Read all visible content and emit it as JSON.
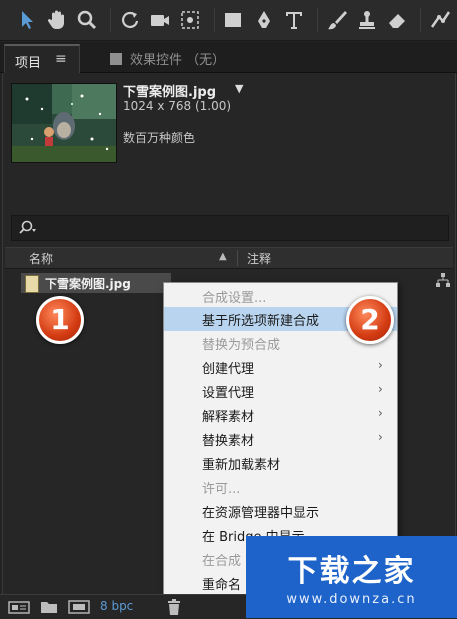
{
  "panel": {
    "project_tab": "项目",
    "project_menu": "≡",
    "effects_tab": "效果控件 （无）"
  },
  "footage": {
    "name": "下雪案例图.jpg",
    "caret": "▼",
    "dimensions": "1024 x 768 (1.00)",
    "colors": "数百万种颜色"
  },
  "columns": {
    "name": "名称",
    "sort": "▲",
    "comment": "注释"
  },
  "file_row": {
    "name": "下雪案例图.jpg"
  },
  "context_menu": {
    "items": [
      {
        "label": "合成设置...",
        "disabled": true
      },
      {
        "label": "基于所选项新建合成",
        "highlighted": true
      },
      {
        "label": "替换为预合成",
        "disabled": true
      },
      {
        "label": "创建代理",
        "submenu": true
      },
      {
        "label": "设置代理",
        "submenu": true
      },
      {
        "label": "解释素材",
        "submenu": true
      },
      {
        "label": "替换素材",
        "submenu": true
      },
      {
        "label": "重新加载素材"
      },
      {
        "label": "许可...",
        "disabled": true
      },
      {
        "label": "在资源管理器中显示"
      },
      {
        "label": "在 Bridge 中显示"
      },
      {
        "label": "在合成",
        "disabled": true
      },
      {
        "label": "重命名"
      }
    ],
    "arrow": "›"
  },
  "badges": {
    "one": "1",
    "two": "2"
  },
  "bottom": {
    "bpc": "8 bpc"
  },
  "watermark": {
    "title": "下载之家",
    "url": "www.downza.cn"
  },
  "colors": {
    "highlight": "#b8d4ef",
    "badge": "#d33b12",
    "watermark": "#1d63c9",
    "bpc": "#5b9bd5"
  }
}
